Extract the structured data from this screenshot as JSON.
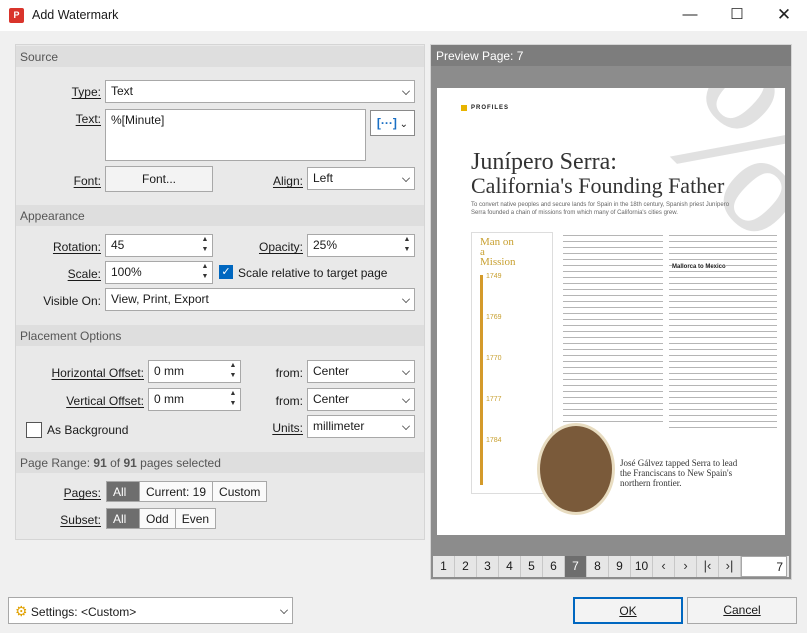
{
  "window": {
    "title": "Add Watermark"
  },
  "source": {
    "heading": "Source",
    "type_label": "Type:",
    "type_value": "Text",
    "text_label": "Text:",
    "text_value": "%[Minute]",
    "font_label": "Font:",
    "font_button": "Font...",
    "align_label": "Align:",
    "align_value": "Left"
  },
  "appearance": {
    "heading": "Appearance",
    "rotation_label": "Rotation:",
    "rotation_value": "45",
    "opacity_label": "Opacity:",
    "opacity_value": "25%",
    "scale_label": "Scale:",
    "scale_value": "100%",
    "scale_relative_label": "Scale relative to target page",
    "scale_relative_checked": true,
    "visible_label": "Visible On:",
    "visible_value": "View, Print, Export"
  },
  "placement": {
    "heading": "Placement Options",
    "h_offset_label": "Horizontal Offset:",
    "h_offset_value": "0 mm",
    "v_offset_label": "Vertical Offset:",
    "v_offset_value": "0 mm",
    "from_label": "from:",
    "h_from_value": "Center",
    "v_from_value": "Center",
    "background_label": "As Background",
    "units_label": "Units:",
    "units_value": "millimeter"
  },
  "page_range": {
    "heading_prefix": "Page Range:",
    "selected": "91",
    "of": "of",
    "total": "91",
    "suffix": "pages selected",
    "pages_label": "Pages:",
    "pages_options": [
      "All",
      "Current: 19",
      "Custom"
    ],
    "subset_label": "Subset:",
    "subset_options": [
      "All",
      "Odd",
      "Even"
    ]
  },
  "preview": {
    "heading": "Preview Page: 7",
    "page_numbers": [
      "1",
      "2",
      "3",
      "4",
      "5",
      "6",
      "7",
      "8",
      "9",
      "10"
    ],
    "current_page": "7",
    "doc": {
      "kicker": "PROFILES",
      "title_line1": "Junípero Serra:",
      "title_line2": "California's Founding Father",
      "intro": "To convert native peoples and secure lands for Spain in the 18th century, Spanish priest Junípero Serra founded a chain of missions from which many of California's cities grew.",
      "sidebar_title": "Man on a Mission",
      "years": [
        "1749",
        "1769",
        "1770",
        "1777",
        "1784"
      ],
      "caption": "José Gálvez tapped Serra to lead the Franciscans to New Spain's northern frontier.",
      "subhead": "Mallorca to Mexico"
    }
  },
  "footer": {
    "settings_label": "Settings:",
    "settings_value": "<Custom>",
    "ok_label": "OK",
    "cancel_label": "Cancel"
  }
}
